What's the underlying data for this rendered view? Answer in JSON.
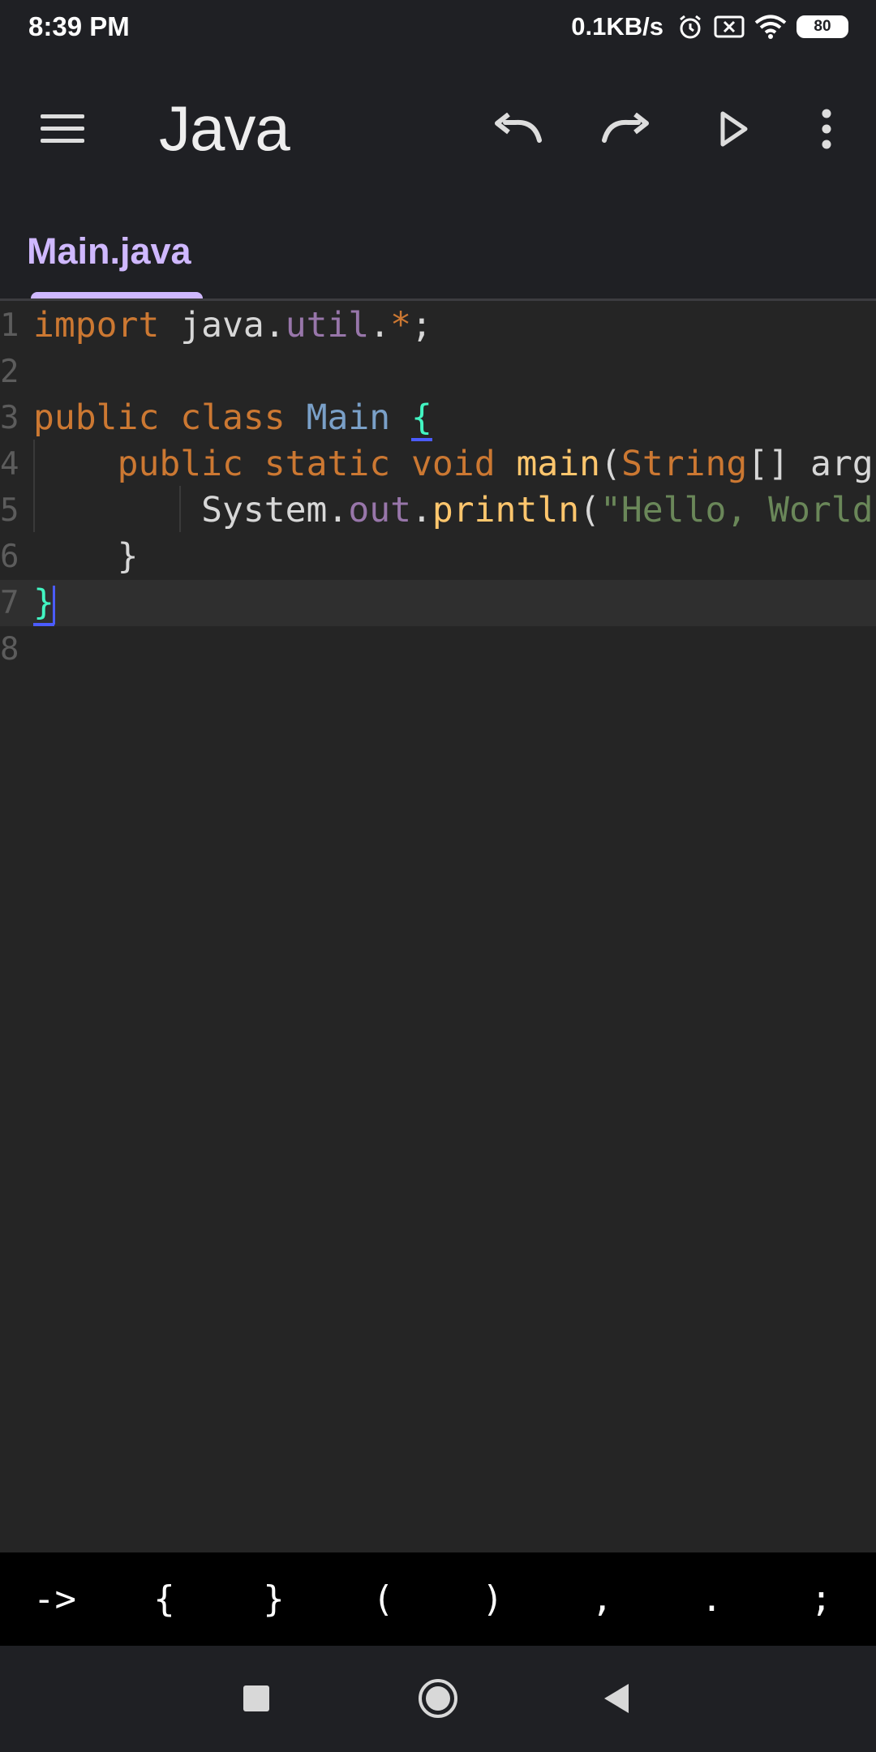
{
  "status_bar": {
    "time": "8:39 PM",
    "network_speed": "0.1KB/s",
    "battery": "80",
    "icons": [
      "alarm-icon",
      "no-sim-icon",
      "wifi-icon",
      "battery-icon"
    ]
  },
  "app_bar": {
    "title": "Java",
    "actions": [
      "undo-icon",
      "redo-icon",
      "run-icon",
      "more-options-icon"
    ]
  },
  "tabs": [
    {
      "label": "Main.java",
      "active": true
    }
  ],
  "editor": {
    "line_numbers": [
      "1",
      "2",
      "3",
      "4",
      "5",
      "6",
      "7",
      "8"
    ],
    "current_line": 7,
    "lines": [
      [
        "import",
        " java.",
        "util",
        ".",
        "*",
        ";"
      ],
      [],
      [
        "public",
        " ",
        "class",
        " ",
        "Main",
        " ",
        "{"
      ],
      [
        "    ",
        "public",
        " ",
        "static",
        " ",
        "void",
        " ",
        "main",
        "(",
        "String",
        "[] arg"
      ],
      [
        "        ",
        "System.",
        "out",
        ".",
        "println",
        "(",
        "\"Hello, World"
      ],
      [
        "    ",
        "}"
      ],
      [
        "}"
      ],
      []
    ]
  },
  "symbol_bar": {
    "keys": [
      "->",
      "{",
      "}",
      "(",
      ")",
      ",",
      ".",
      ";"
    ]
  },
  "nav_bar": {
    "buttons": [
      "recents-icon",
      "home-icon",
      "back-icon"
    ]
  },
  "colors": {
    "background": "#202124",
    "editor_background": "#252525",
    "accent": "#cfb8ff",
    "keyword": "#cc7832",
    "type": "#7aa0c8",
    "member": "#9876aa",
    "function": "#ffc66d",
    "string": "#6a8759",
    "brace": "#42f5c2"
  }
}
